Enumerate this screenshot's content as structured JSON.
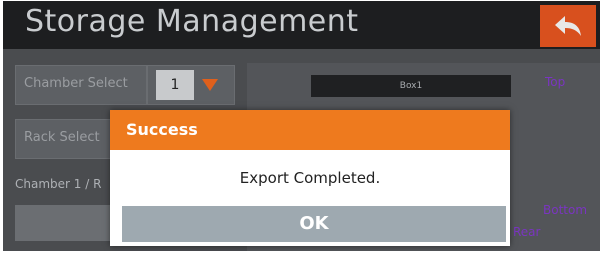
{
  "header": {
    "title": "Storage Management",
    "back_icon": "back-arrow-icon"
  },
  "form": {
    "chamber_label": "Chamber Select",
    "chamber_value": "1",
    "rack_label": "Rack Select",
    "path_label": "Chamber 1 / R"
  },
  "storage_view": {
    "box_label": "Box1",
    "top_label": "Top",
    "bottom_label": "Bottom",
    "rear_label": "Rear"
  },
  "dialog": {
    "title": "Success",
    "message": "Export Completed.",
    "ok_label": "OK"
  },
  "colors": {
    "accent": "#ee7a1e",
    "back_button": "#d8501e",
    "header_bg": "#1d1e20",
    "ok_button": "#9ea9b0",
    "position_labels": "#7a35c0"
  }
}
